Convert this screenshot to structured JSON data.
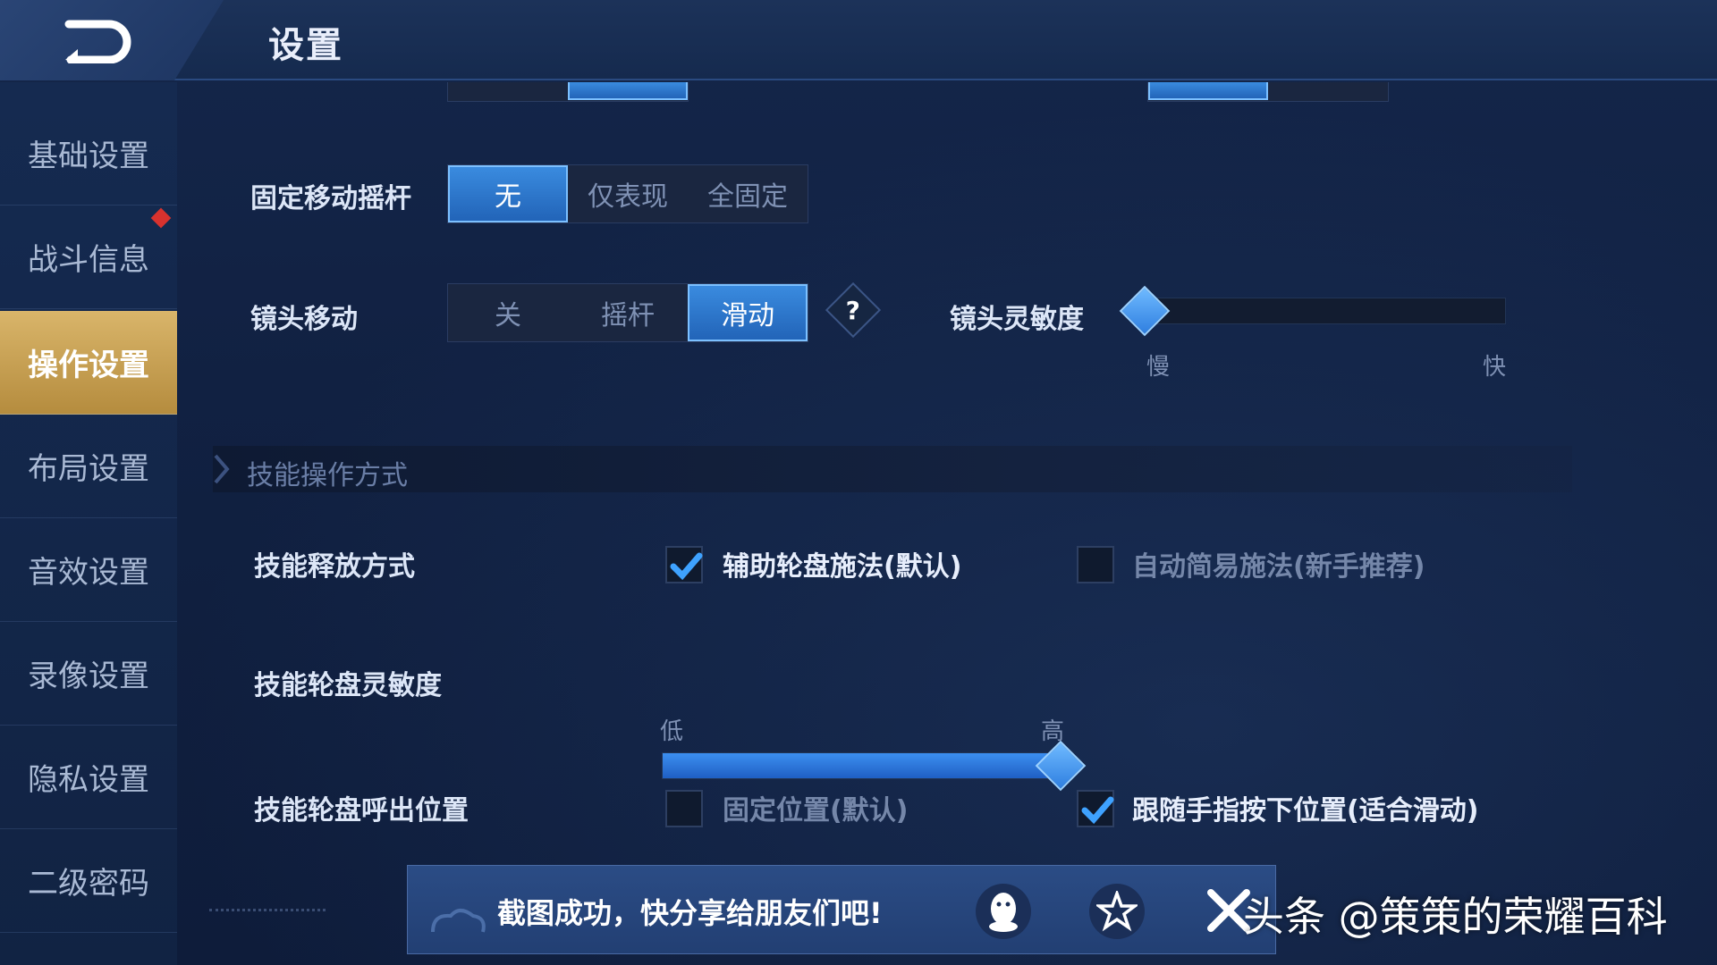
{
  "header": {
    "title": "设置"
  },
  "sidebar": {
    "items": [
      {
        "label": "基础设置"
      },
      {
        "label": "战斗信息"
      },
      {
        "label": "操作设置"
      },
      {
        "label": "布局设置"
      },
      {
        "label": "音效设置"
      },
      {
        "label": "录像设置"
      },
      {
        "label": "隐私设置"
      },
      {
        "label": "二级密码"
      }
    ],
    "active_index": 2
  },
  "settings": {
    "fixed_joystick": {
      "label": "固定移动摇杆",
      "options": [
        "无",
        "仅表现",
        "全固定"
      ],
      "selected": "无"
    },
    "camera_move": {
      "label": "镜头移动",
      "options": [
        "关",
        "摇杆",
        "滑动"
      ],
      "selected": "滑动",
      "help": "?"
    },
    "camera_sensitivity": {
      "label": "镜头灵敏度",
      "min_label": "慢",
      "max_label": "快",
      "value": 0.0
    },
    "skill_section": {
      "title": "技能操作方式"
    },
    "skill_release": {
      "label": "技能释放方式",
      "options": [
        {
          "label": "辅助轮盘施法(默认)",
          "checked": true
        },
        {
          "label": "自动简易施法(新手推荐)",
          "checked": false
        }
      ]
    },
    "skill_wheel_sensitivity": {
      "label": "技能轮盘灵敏度",
      "min_label": "低",
      "max_label": "高",
      "value": 1.0
    },
    "skill_wheel_position": {
      "label": "技能轮盘呼出位置",
      "options": [
        {
          "label": "固定位置(默认)",
          "checked": false
        },
        {
          "label": "跟随手指按下位置(适合滑动)",
          "checked": true
        }
      ]
    }
  },
  "toast": {
    "message": "截图成功，快分享给朋友们吧!",
    "share_icons": [
      "qq-icon",
      "qzone-icon"
    ]
  },
  "watermark": "头条 @策策的荣耀百科",
  "colors": {
    "accent_blue": "#2f7fe0",
    "active_tab_gold": "#d9b56a",
    "badge_red": "#d8322e"
  }
}
